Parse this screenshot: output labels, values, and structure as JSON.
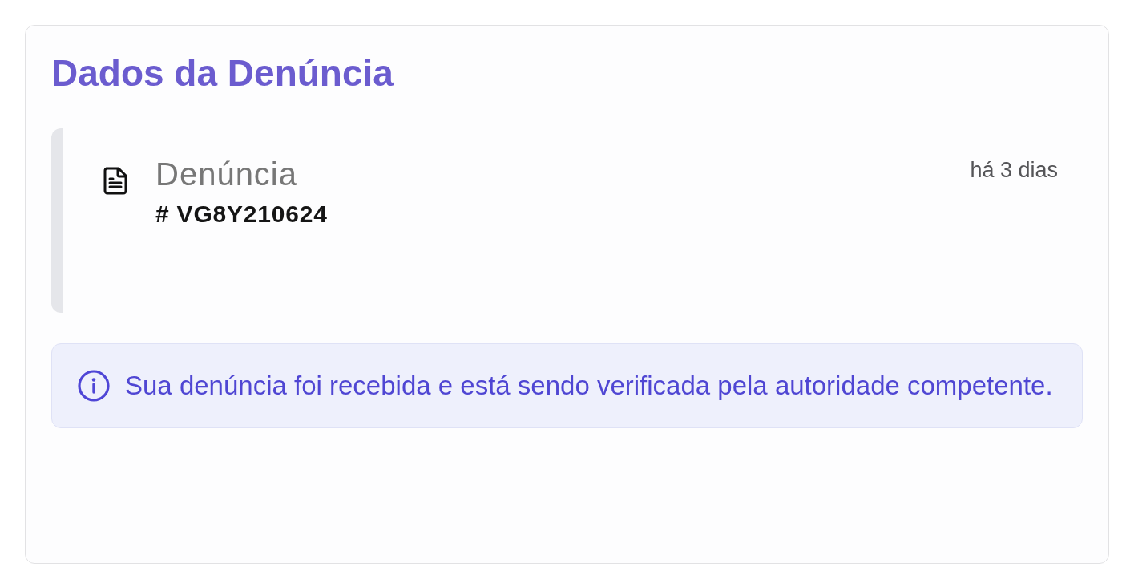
{
  "title": "Dados da Denúncia",
  "entries": [
    {
      "kind": "document",
      "title": "Denúncia",
      "code": "# VG8Y210624",
      "time": "há 3 dias"
    }
  ],
  "alert": {
    "kind": "info",
    "text": "Sua denúncia foi recebida e está sendo verificada pela autoridade competente."
  }
}
